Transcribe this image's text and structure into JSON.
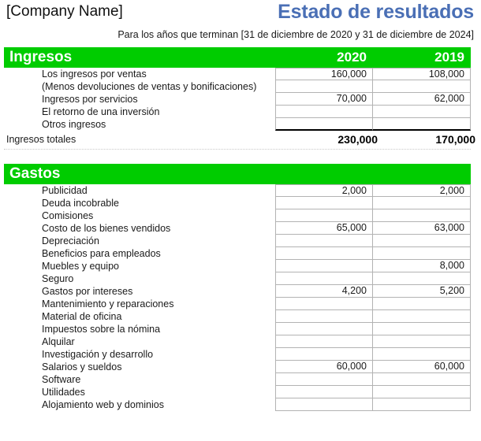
{
  "document": {
    "company_name": "[Company Name]",
    "title": "Estado de resultados",
    "period": "Para los años que terminan [31 de diciembre de 2020 y 31 de diciembre de 2024]",
    "accent_green": "#00CC00",
    "title_blue": "#4A6FB5"
  },
  "columns": {
    "year_1": "2020",
    "year_2": "2019"
  },
  "sections": [
    {
      "id": "ingresos",
      "heading": "Ingresos",
      "rows": [
        {
          "label": "Los ingresos por ventas",
          "y1": "160,000",
          "y2": "108,000"
        },
        {
          "label": "(Menos devoluciones de ventas y bonificaciones)",
          "y1": "",
          "y2": ""
        },
        {
          "label": "Ingresos por servicios",
          "y1": "70,000",
          "y2": "62,000"
        },
        {
          "label": "El retorno de una inversión",
          "y1": "",
          "y2": ""
        },
        {
          "label": "Otros ingresos",
          "y1": "",
          "y2": ""
        }
      ],
      "total": {
        "label": "Ingresos totales",
        "y1": "230,000",
        "y2": "170,000"
      }
    },
    {
      "id": "gastos",
      "heading": "Gastos",
      "rows": [
        {
          "label": "Publicidad",
          "y1": "2,000",
          "y2": "2,000"
        },
        {
          "label": "Deuda incobrable",
          "y1": "",
          "y2": ""
        },
        {
          "label": "Comisiones",
          "y1": "",
          "y2": ""
        },
        {
          "label": "Costo de los bienes vendidos",
          "y1": "65,000",
          "y2": "63,000"
        },
        {
          "label": "Depreciación",
          "y1": "",
          "y2": ""
        },
        {
          "label": "Beneficios para empleados",
          "y1": "",
          "y2": ""
        },
        {
          "label": "Muebles y equipo",
          "y1": "",
          "y2": "8,000"
        },
        {
          "label": "Seguro",
          "y1": "",
          "y2": ""
        },
        {
          "label": "Gastos por intereses",
          "y1": "4,200",
          "y2": "5,200"
        },
        {
          "label": "Mantenimiento y reparaciones",
          "y1": "",
          "y2": ""
        },
        {
          "label": "Material de oficina",
          "y1": "",
          "y2": ""
        },
        {
          "label": "Impuestos sobre la nómina",
          "y1": "",
          "y2": ""
        },
        {
          "label": "Alquilar",
          "y1": "",
          "y2": ""
        },
        {
          "label": "Investigación y desarrollo",
          "y1": "",
          "y2": ""
        },
        {
          "label": "Salarios y sueldos",
          "y1": "60,000",
          "y2": "60,000"
        },
        {
          "label": "Software",
          "y1": "",
          "y2": ""
        },
        {
          "label": "Utilidades",
          "y1": "",
          "y2": ""
        },
        {
          "label": "Alojamiento web y dominios",
          "y1": "",
          "y2": ""
        }
      ],
      "total": null
    }
  ]
}
